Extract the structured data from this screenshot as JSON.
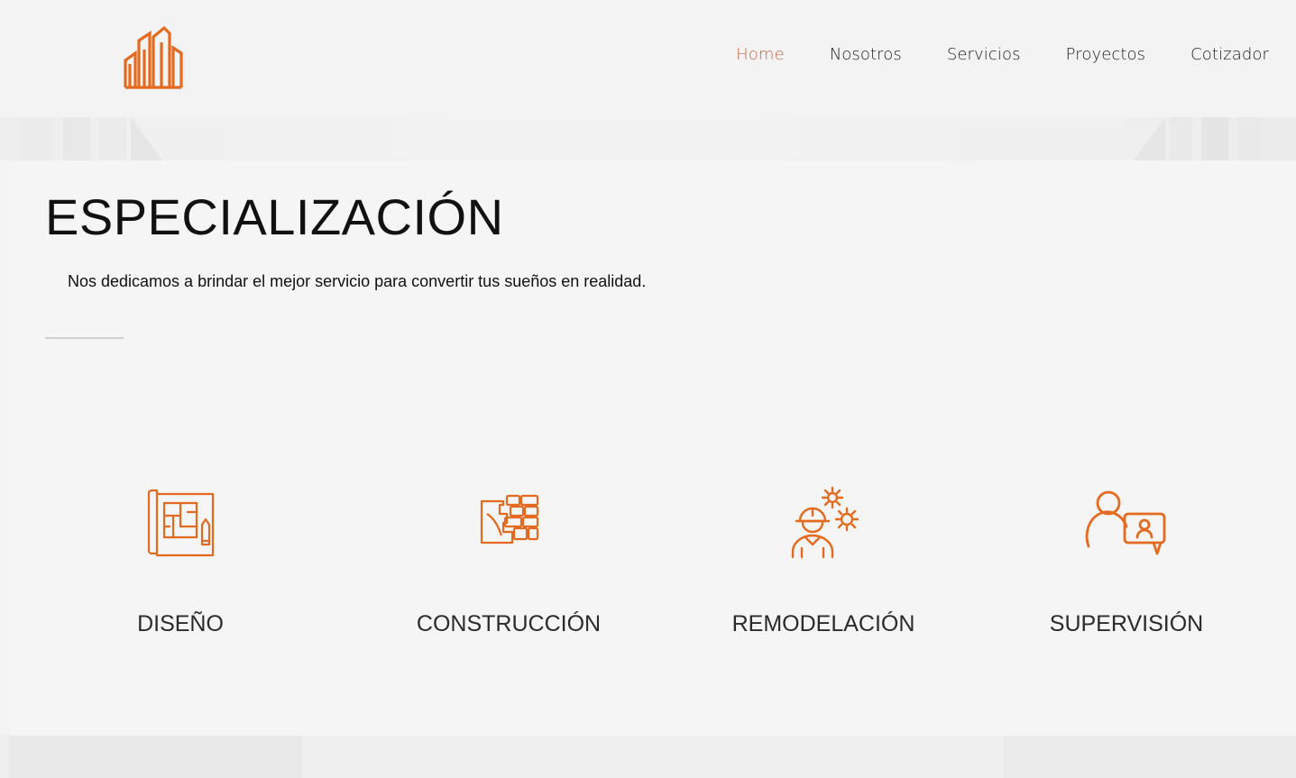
{
  "colors": {
    "accent": "#e36a1e",
    "nav_active": "#c8684a",
    "text": "#111111"
  },
  "header": {
    "logo_icon": "building-logo-icon",
    "nav": [
      {
        "label": "Home",
        "active": true
      },
      {
        "label": "Nosotros",
        "active": false
      },
      {
        "label": "Servicios",
        "active": false
      },
      {
        "label": "Proyectos",
        "active": false
      },
      {
        "label": "Cotizador",
        "active": false
      }
    ]
  },
  "section": {
    "title": "ESPECIALIZACIÓN",
    "subtitle": "Nos dedicamos a brindar el mejor servicio para convertir tus sueños en realidad."
  },
  "services": [
    {
      "label": "DISEÑO",
      "icon": "blueprint-icon"
    },
    {
      "label": "CONSTRUCCIÓN",
      "icon": "brick-wall-icon"
    },
    {
      "label": "REMODELACIÓN",
      "icon": "worker-gears-icon"
    },
    {
      "label": "SUPERVISIÓN",
      "icon": "supervisor-chat-icon"
    }
  ]
}
